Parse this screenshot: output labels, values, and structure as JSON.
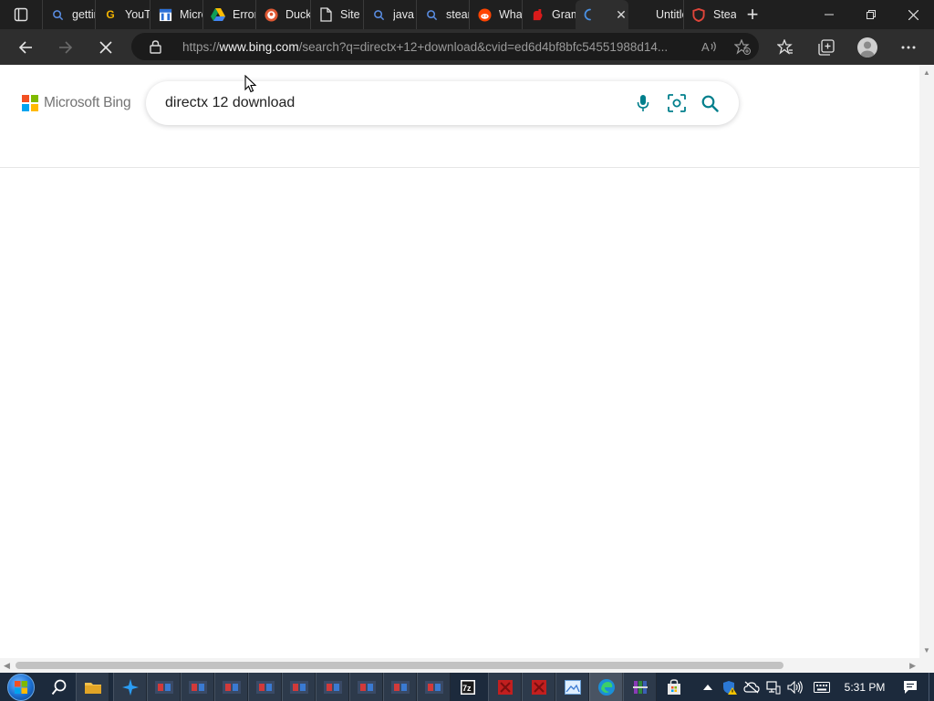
{
  "browser": {
    "tabs": [
      {
        "title": "getting",
        "icon": "bing-search-icon",
        "active": false
      },
      {
        "title": "YouTube",
        "icon": "google-g-icon",
        "active": false
      },
      {
        "title": "Microsoft",
        "icon": "calendar-page-icon",
        "active": false
      },
      {
        "title": "Error",
        "icon": "google-drive-icon",
        "active": false
      },
      {
        "title": "DuckDuckGo",
        "icon": "duckduckgo-icon",
        "active": false
      },
      {
        "title": "Site",
        "icon": "document-icon",
        "active": false
      },
      {
        "title": "java",
        "icon": "bing-search-icon",
        "active": false
      },
      {
        "title": "steam",
        "icon": "bing-search-icon",
        "active": false
      },
      {
        "title": "What",
        "icon": "reddit-icon",
        "active": false
      },
      {
        "title": "Grammarly",
        "icon": "red-glove-icon",
        "active": false
      },
      {
        "title": "",
        "icon": "loading-spinner-icon",
        "active": true
      },
      {
        "title": "Untitled",
        "icon": "",
        "active": false
      },
      {
        "title": "Steam",
        "icon": "shield-icon",
        "active": false
      }
    ],
    "url": {
      "scheme": "https://",
      "host": "www.bing.com",
      "path": "/search?q=directx+12+download&cvid=ed6d4bf8bfc54551988d14..."
    }
  },
  "bing": {
    "brand": "Microsoft Bing",
    "query": "directx 12 download"
  },
  "taskbar": {
    "time": "5:31 PM"
  },
  "colors": {
    "tabstrip_bg": "#1f1f1f",
    "toolbar_bg": "#2e2e2e",
    "bing_accent": "#007f8c",
    "taskbar_bg": "#1c2a3c"
  }
}
